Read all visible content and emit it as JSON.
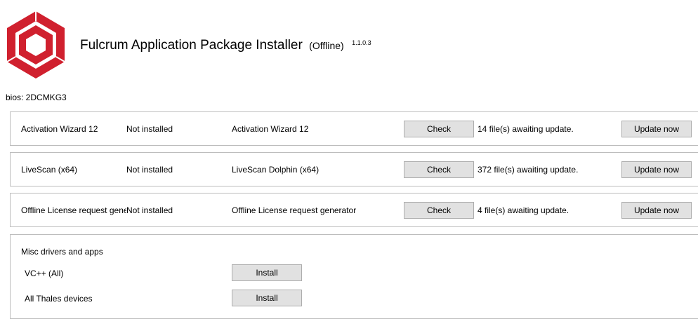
{
  "app": {
    "title": "Fulcrum Application Package Installer",
    "mode": "(Offline)",
    "version": "1.1.0.3",
    "bios": "bios: 2DCMKG3",
    "logo_color": "#d0202e"
  },
  "packages": [
    {
      "name": "Activation Wizard 12",
      "status": "Not installed",
      "package": "Activation Wizard 12",
      "check_label": "Check",
      "info": "14 file(s) awaiting update.",
      "update_label": "Update now"
    },
    {
      "name": "LiveScan (x64)",
      "status": "Not installed",
      "package": "LiveScan Dolphin (x64)",
      "check_label": "Check",
      "info": "372 file(s) awaiting update.",
      "update_label": "Update now"
    },
    {
      "name": "Offline License request generator",
      "status": "Not installed",
      "package": "Offline License request generator",
      "check_label": "Check",
      "info": "4 file(s) awaiting update.",
      "update_label": "Update now"
    }
  ],
  "misc": {
    "title": "Misc drivers and apps",
    "items": [
      {
        "label": "VC++ (All)",
        "button": "Install"
      },
      {
        "label": "All Thales devices",
        "button": "Install"
      }
    ]
  }
}
